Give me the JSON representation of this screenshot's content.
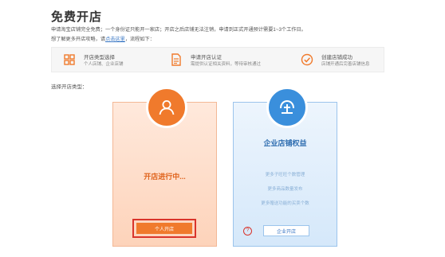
{
  "page": {
    "title": "免费开店",
    "desc_line1": "申请淘宝店铺完全免费；一个身份证只能开一家店；开店之后店铺无法注销，申请到正式开通预计需要1~3个工作日。",
    "desc_line2_prefix": "想了解更多开店攻略，请",
    "desc_line2_link": "点击这里",
    "desc_line2_suffix": "，流程如下："
  },
  "steps": [
    {
      "title": "开店类型选择",
      "subtitle": "个人店铺、企业店铺",
      "icon": "grid-icon"
    },
    {
      "title": "申请开店认证",
      "subtitle": "需提供认证相关资料，等待审核通过",
      "icon": "document-icon"
    },
    {
      "title": "创建店铺成功",
      "subtitle": "店铺开通后完善店铺信息",
      "icon": "check-circle-icon"
    }
  ],
  "choose_label": "选择开店类型：",
  "personal_card": {
    "status": "开店进行中...",
    "button_label": "个人开店",
    "icon": "person-icon",
    "accent": "#f07a2c"
  },
  "enterprise_card": {
    "title": "企业店铺权益",
    "benefits": [
      "更多子旺旺个数管理",
      "更多商品数量发布",
      "更多赠送功能的买卖个数"
    ],
    "button_label": "企业开店",
    "help_label": "?",
    "icon": "enterprise-icon",
    "accent": "#3a8fdc"
  },
  "colors": {
    "highlight_frame": "#d9342b",
    "link": "#3a77c4"
  }
}
